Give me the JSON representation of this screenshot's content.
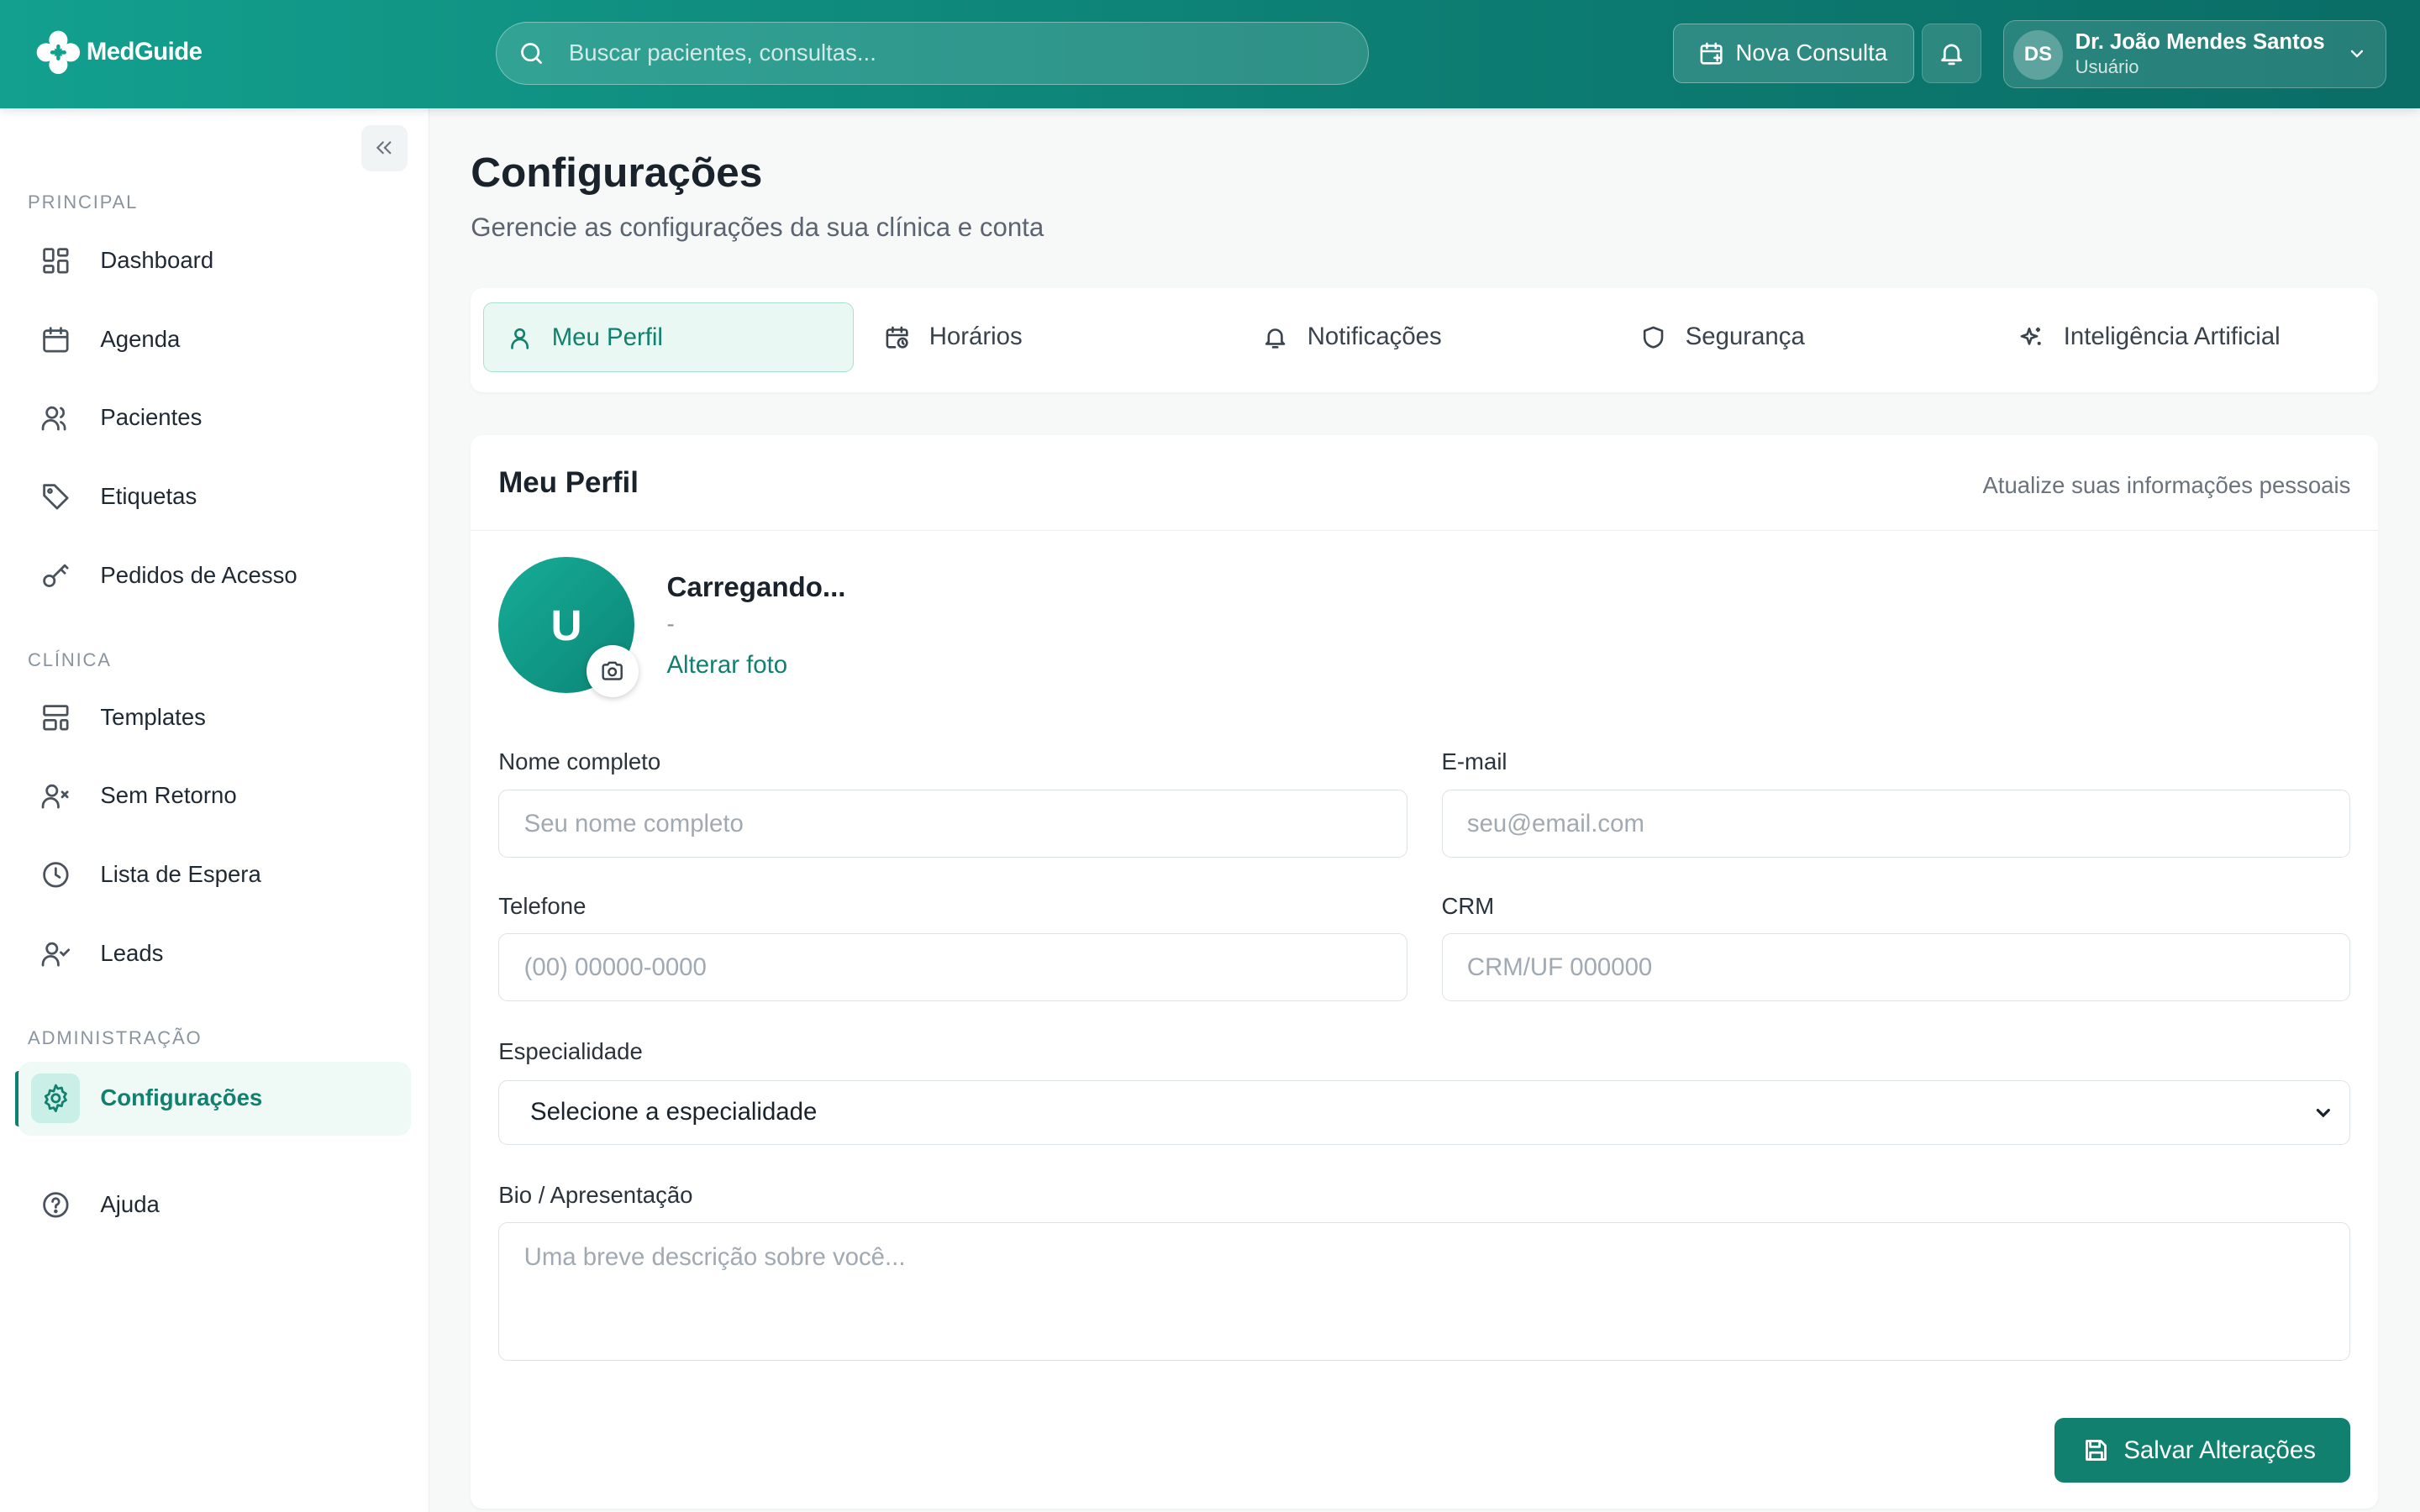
{
  "header": {
    "logo_text": "MedGuide",
    "search_placeholder": "Buscar pacientes, consultas...",
    "new_consult_label": "Nova Consulta",
    "user": {
      "initials": "DS",
      "name": "Dr. João Mendes Santos",
      "role": "Usuário"
    }
  },
  "sidebar": {
    "sections": {
      "principal": "PRINCIPAL",
      "clinica": "CLÍNICA",
      "admin": "ADMINISTRAÇÃO"
    },
    "items": {
      "dashboard": "Dashboard",
      "agenda": "Agenda",
      "pacientes": "Pacientes",
      "etiquetas": "Etiquetas",
      "pedidos": "Pedidos de Acesso",
      "templates": "Templates",
      "sem_retorno": "Sem Retorno",
      "lista_espera": "Lista de Espera",
      "leads": "Leads",
      "configuracoes": "Configurações",
      "ajuda": "Ajuda"
    },
    "active_item": "configuracoes"
  },
  "page": {
    "title": "Configurações",
    "subtitle": "Gerencie as configurações da sua clínica e conta"
  },
  "tabs": {
    "perfil": "Meu Perfil",
    "horarios": "Horários",
    "notificacoes": "Notificações",
    "seguranca": "Segurança",
    "ia": "Inteligência Artificial",
    "active": "perfil"
  },
  "profile_card": {
    "title": "Meu Perfil",
    "hint": "Atualize suas informações pessoais",
    "avatar_initial": "U",
    "name": "Carregando...",
    "sub": "-",
    "change_photo": "Alterar foto",
    "fields": {
      "nome_label": "Nome completo",
      "nome_placeholder": "Seu nome completo",
      "email_label": "E-mail",
      "email_placeholder": "seu@email.com",
      "telefone_label": "Telefone",
      "telefone_placeholder": "(00) 00000-0000",
      "crm_label": "CRM",
      "crm_placeholder": "CRM/UF 000000",
      "especialidade_label": "Especialidade",
      "especialidade_value": "Selecione a especialidade",
      "bio_label": "Bio / Apresentação",
      "bio_placeholder": "Uma breve descrição sobre você..."
    },
    "save_label": "Salvar Alterações"
  },
  "colors": {
    "brand": "#11806f",
    "header_start": "#13a08e",
    "header_end": "#0a6d66",
    "active_bg": "#effaf7"
  }
}
